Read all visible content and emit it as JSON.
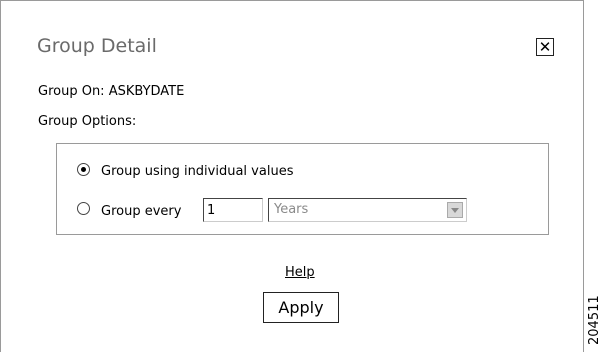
{
  "dialog": {
    "title": "Group Detail",
    "close_symbol": "✕",
    "close_icon": "close-icon",
    "group_on_text": "Group On: ASKBYDATE",
    "group_options_label": "Group Options:",
    "options": {
      "individual": {
        "label": "Group using individual values",
        "checked": true
      },
      "every": {
        "label": "Group every",
        "checked": false,
        "count_value": "1",
        "unit_selected": "Years",
        "unit_icon": "chevron-down-icon"
      }
    },
    "help_link": "Help",
    "apply_button": "Apply"
  },
  "figure_id": "204511"
}
